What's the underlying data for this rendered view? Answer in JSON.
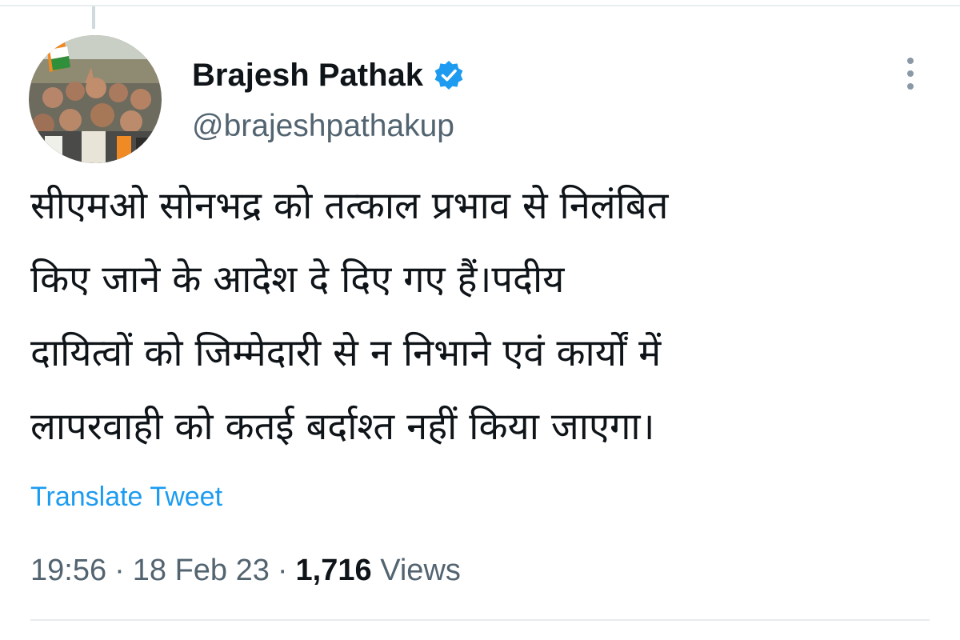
{
  "tweet": {
    "author": {
      "display_name": "Brajesh Pathak",
      "handle": "@brajeshpathakup",
      "verified": true,
      "avatar_icon": "profile-photo-crowd"
    },
    "text_lines": [
      "सीएमओ सोनभद्र को तत्काल प्रभाव से निलंबित",
      "किए जाने के आदेश दे दिए गए हैं।पदीय",
      "दायित्वों को जिम्मेदारी से न निभाने एवं कार्यों में",
      "लापरवाही को कतई बर्दाश्त नहीं किया जाएगा।"
    ],
    "translate_label": "Translate Tweet",
    "time": "19:56",
    "date": "18 Feb 23",
    "separator": "·",
    "views_count": "1,716",
    "views_label": "Views"
  },
  "colors": {
    "link": "#1d9bf0",
    "verified": "#1d9bf0",
    "secondary_text": "#536471",
    "primary_text": "#0f1419",
    "divider": "#e7ecef"
  },
  "icons": {
    "verified": "verified-badge-icon",
    "more": "more-options-icon"
  }
}
